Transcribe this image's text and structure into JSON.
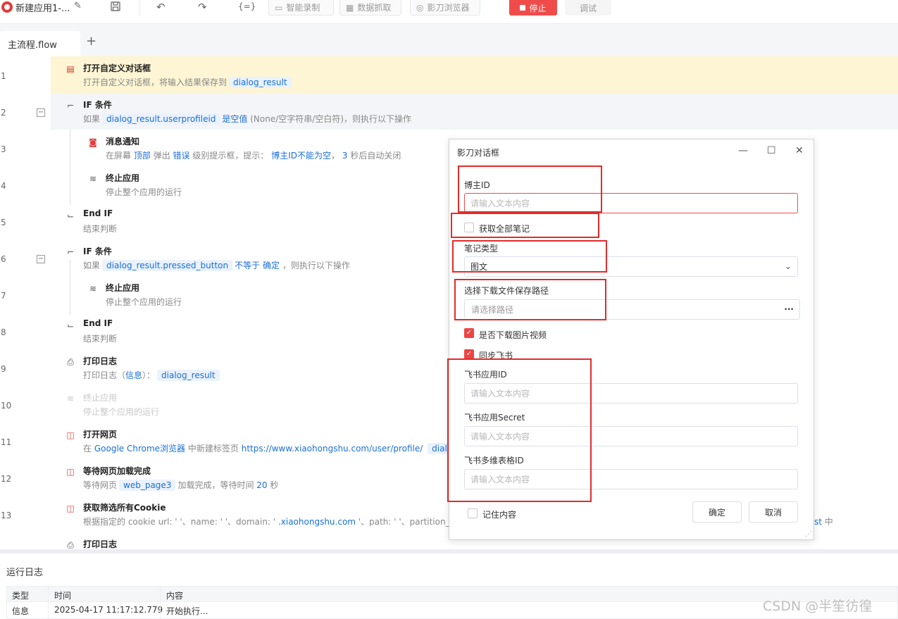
{
  "app": {
    "title": "新建应用1-..."
  },
  "toolbar": {
    "smart_record": "智能录制",
    "data_capture": "数据抓取",
    "browser": "影刀浏览器",
    "stop": "停止",
    "debug": "调试",
    "code_icon": "{=}"
  },
  "tabs": [
    {
      "label": "主流程.flow"
    }
  ],
  "steps": [
    {
      "line": "1",
      "title": "打开自定义对话框",
      "desc_pre": "打开自定义对话框，将输入结果保存到",
      "var": "dialog_result"
    },
    {
      "line": "2",
      "title": "IF 条件",
      "desc_pre": "如果",
      "var": "dialog_result.userprofileid",
      "kw": "是空值",
      "desc_post": "(None/空字符串/空白符)，则执行以下操作"
    },
    {
      "line": "3",
      "title": "消息通知",
      "d1": "在屏幕",
      "d2": "顶部",
      "d3": "弹出",
      "d4": "错误",
      "d5": "级别提示框，提示：",
      "d6": "博主ID不能为空",
      "d7": "，",
      "d8": "3",
      "d9": "秒后自动关闭"
    },
    {
      "line": "4",
      "title": "终止应用",
      "desc": "停止整个应用的运行"
    },
    {
      "line": "5",
      "title": "End IF",
      "desc": "结束判断"
    },
    {
      "line": "6",
      "title": "IF 条件",
      "desc_pre": "如果",
      "var": "dialog_result.pressed_button",
      "kw": "不等于",
      "kw2": "确定",
      "desc_post": "，则执行以下操作"
    },
    {
      "line": "7",
      "title": "终止应用",
      "desc": "停止整个应用的运行"
    },
    {
      "line": "8",
      "title": "End IF",
      "desc": "结束判断"
    },
    {
      "line": "9",
      "title": "打印日志",
      "desc_pre": "打印日志（",
      "kw": "信息",
      "desc_mid": "）：",
      "var": "dialog_result"
    },
    {
      "line": "10",
      "title": "终止应用",
      "desc": "停止整个应用的运行"
    },
    {
      "line": "11",
      "title": "打开网页",
      "desc_pre": "在",
      "kw": "Google Chrome浏览器",
      "desc_mid": "中新建标签页",
      "kw2": "https://www.xiaohongshu.com/user/profile/",
      "var": "dialo"
    },
    {
      "line": "12",
      "title": "等待网页加载完成",
      "desc_pre": "等待网页",
      "var": "web_page3",
      "desc_mid": "加载完成，等待时间",
      "kw": "20",
      "desc_post": "秒"
    },
    {
      "line": "13",
      "title": "获取筛选所有Cookie",
      "desc_pre": "根据指定的 cookie url: '  '、name: '  '、domain: '",
      "kw": ".xiaohongshu.com",
      "desc_post": "'、path: '  '、partition_k",
      "tail_kw": "st",
      "tail": "中"
    },
    {
      "line": "",
      "title": "打印日志"
    }
  ],
  "dialog": {
    "title": "影刀对话框",
    "blogger_id_label": "博主ID",
    "blogger_id_placeholder": "请输入文本内容",
    "get_all_notes": "获取全部笔记",
    "note_type_label": "笔记类型",
    "note_type_value": "图文",
    "save_path_label": "选择下载文件保存路径",
    "save_path_placeholder": "请选择路径",
    "download_media": "是否下载图片视频",
    "sync_feishu": "同步飞书",
    "feishu_app_id_label": "飞书应用ID",
    "feishu_app_id_placeholder": "请输入文本内容",
    "feishu_secret_label": "飞书应用Secret",
    "feishu_secret_placeholder": "请输入文本内容",
    "feishu_table_label": "飞书多维表格ID",
    "feishu_table_placeholder": "请输入文本内容",
    "remember": "记住内容",
    "ok": "确定",
    "cancel": "取消",
    "get_all_notes_checked": false,
    "download_media_checked": true,
    "sync_feishu_checked": true,
    "remember_checked": false
  },
  "log": {
    "title": "运行日志",
    "columns": [
      "类型",
      "时间",
      "内容"
    ],
    "rows": [
      {
        "type": "信息",
        "time": "2025-04-17 11:17:12.779",
        "content": "开始执行..."
      }
    ]
  },
  "watermark": "CSDN @半笙彷徨",
  "colors": {
    "accent": "#1a6fd8",
    "stop": "#f04b4b",
    "highlight": "#fdf5d3",
    "annotation": "#e22b2b"
  }
}
